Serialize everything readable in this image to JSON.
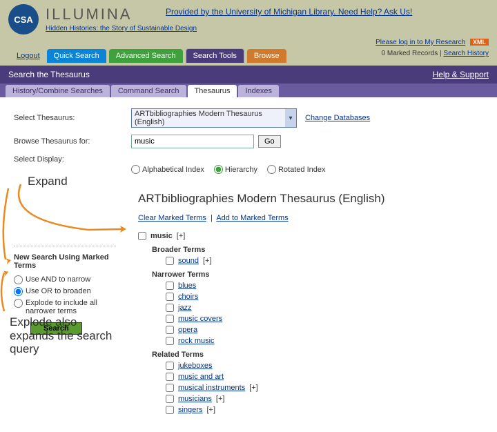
{
  "header": {
    "logo_acronym": "CSA",
    "brand": "ILLUMINA",
    "tagline": "Hidden Histories: the Story of Sustainable Design",
    "provided_by": "Provided by the University of Michigan Library. Need Help? Ask Us!",
    "login_link": "Please log in to My Research",
    "xml_badge": "XML",
    "marked_records": "0 Marked Records",
    "search_history": "Search History",
    "logout": "Logout"
  },
  "nav": {
    "quick_search": "Quick Search",
    "advanced_search": "Advanced Search",
    "search_tools": "Search Tools",
    "browse": "Browse"
  },
  "purple_bar": {
    "title": "Search the Thesaurus",
    "help": "Help & Support"
  },
  "inner_tabs": {
    "history": "History/Combine Searches",
    "command": "Command Search",
    "thesaurus": "Thesaurus",
    "indexes": "Indexes"
  },
  "form": {
    "select_label": "Select Thesaurus:",
    "thesaurus_value": "ARTbibliographies Modern Thesaurus (English)",
    "change_db": "Change Databases",
    "browse_label": "Browse Thesaurus for:",
    "browse_value": "music",
    "go": "Go",
    "display_label": "Select Display:",
    "opt_alpha": "Alphabetical Index",
    "opt_hier": "Hierarchy",
    "opt_rot": "Rotated Index"
  },
  "results": {
    "heading": "ARTbibliographies Modern Thesaurus (English)",
    "clear": "Clear Marked Terms",
    "add": "Add to Marked Terms",
    "root": "music",
    "root_suffix": "[+]",
    "broader_label": "Broader Terms",
    "broader": [
      {
        "t": "sound",
        "suf": "[+]"
      }
    ],
    "narrower_label": "Narrower Terms",
    "narrower": [
      {
        "t": "blues"
      },
      {
        "t": "choirs"
      },
      {
        "t": "jazz"
      },
      {
        "t": "music covers"
      },
      {
        "t": "opera"
      },
      {
        "t": "rock music"
      }
    ],
    "related_label": "Related Terms",
    "related": [
      {
        "t": "jukeboxes"
      },
      {
        "t": "music and art"
      },
      {
        "t": "musical instruments",
        "suf": "[+]"
      },
      {
        "t": "musicians",
        "suf": "[+]"
      },
      {
        "t": "singers",
        "suf": "[+]"
      }
    ]
  },
  "sidebar": {
    "heading": "New Search Using Marked Terms",
    "and": "Use AND to narrow",
    "or": "Use OR to broaden",
    "explode": "Explode to include all narrower terms",
    "search": "Search"
  },
  "annotations": {
    "expand": "Expand",
    "explode": "Explode also expands the search query"
  }
}
